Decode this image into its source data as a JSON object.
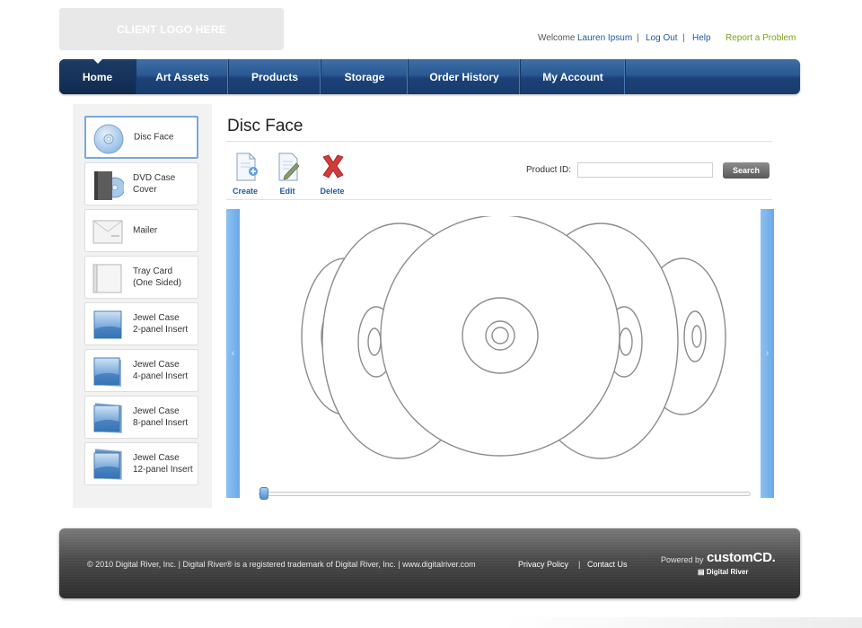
{
  "header": {
    "logo_text": "CLIENT LOGO HERE",
    "welcome": "Welcome",
    "user_name": "Lauren Ipsum",
    "separator": "|",
    "logout": "Log Out",
    "help": "Help",
    "report": "Report a Problem"
  },
  "nav": {
    "tabs": [
      {
        "label": "Home",
        "active": true
      },
      {
        "label": "Art Assets"
      },
      {
        "label": "Products"
      },
      {
        "label": "Storage"
      },
      {
        "label": "Order History"
      },
      {
        "label": "My Account"
      }
    ]
  },
  "sidebar": {
    "items": [
      {
        "label": "Disc Face",
        "icon": "disc-icon",
        "selected": true
      },
      {
        "label": "DVD Case\nCover",
        "icon": "dvd-case-icon"
      },
      {
        "label": "Mailer",
        "icon": "mailer-icon"
      },
      {
        "label": "Tray Card\n(One Sided)",
        "icon": "tray-card-icon"
      },
      {
        "label": "Jewel Case\n2-panel Insert",
        "icon": "jewel-case-2-icon"
      },
      {
        "label": "Jewel Case\n4-panel Insert",
        "icon": "jewel-case-4-icon"
      },
      {
        "label": "Jewel Case\n8-panel Insert",
        "icon": "jewel-case-8-icon"
      },
      {
        "label": "Jewel Case\n12-panel Insert",
        "icon": "jewel-case-12-icon"
      }
    ]
  },
  "main": {
    "title": "Disc Face",
    "toolbar": {
      "create": "Create",
      "edit": "Edit",
      "delete": "Delete"
    },
    "product_id_label": "Product ID:",
    "product_id_value": "",
    "search_label": "Search",
    "viewer": {
      "prev_arrow": "‹",
      "next_arrow": "›",
      "slider_position": 0.0
    }
  },
  "footer": {
    "copyright": "© 2010 Digital River, Inc. | Digital River® is a registered trademark of Digital River, Inc. | www.digitalriver.com",
    "privacy": "Privacy Policy",
    "separator": "|",
    "contact": "Contact Us",
    "powered_by": "Powered by",
    "brand": "customCD.",
    "brand_sub": "Digital River"
  },
  "colors": {
    "accent_blue": "#1f5a99",
    "report_green": "#7aa11a",
    "selected_border": "#76a9df",
    "viewer_arrow": "#7ab4ec"
  }
}
